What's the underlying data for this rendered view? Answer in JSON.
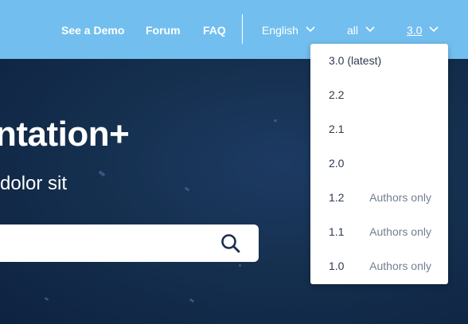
{
  "nav": {
    "links": [
      {
        "label": "See a Demo"
      },
      {
        "label": "Forum"
      },
      {
        "label": "FAQ"
      }
    ],
    "language": {
      "label": "English"
    },
    "scope": {
      "label": "all"
    },
    "version": {
      "label": "3.0"
    }
  },
  "hero": {
    "title": "ntation+",
    "subtitle": "dolor sit"
  },
  "version_menu": {
    "items": [
      {
        "version": "3.0 (latest)",
        "note": ""
      },
      {
        "version": "2.2",
        "note": ""
      },
      {
        "version": "2.1",
        "note": ""
      },
      {
        "version": "2.0",
        "note": ""
      },
      {
        "version": "1.2",
        "note": "Authors only"
      },
      {
        "version": "1.1",
        "note": "Authors only"
      },
      {
        "version": "1.0",
        "note": "Authors only"
      }
    ]
  },
  "colors": {
    "header": "#72bfef",
    "hero_bg": "#13284a",
    "menu_text": "#2d3b50",
    "menu_note": "#727f90"
  },
  "icons": {
    "chevron": "chevron-down-icon",
    "search": "search-icon"
  }
}
